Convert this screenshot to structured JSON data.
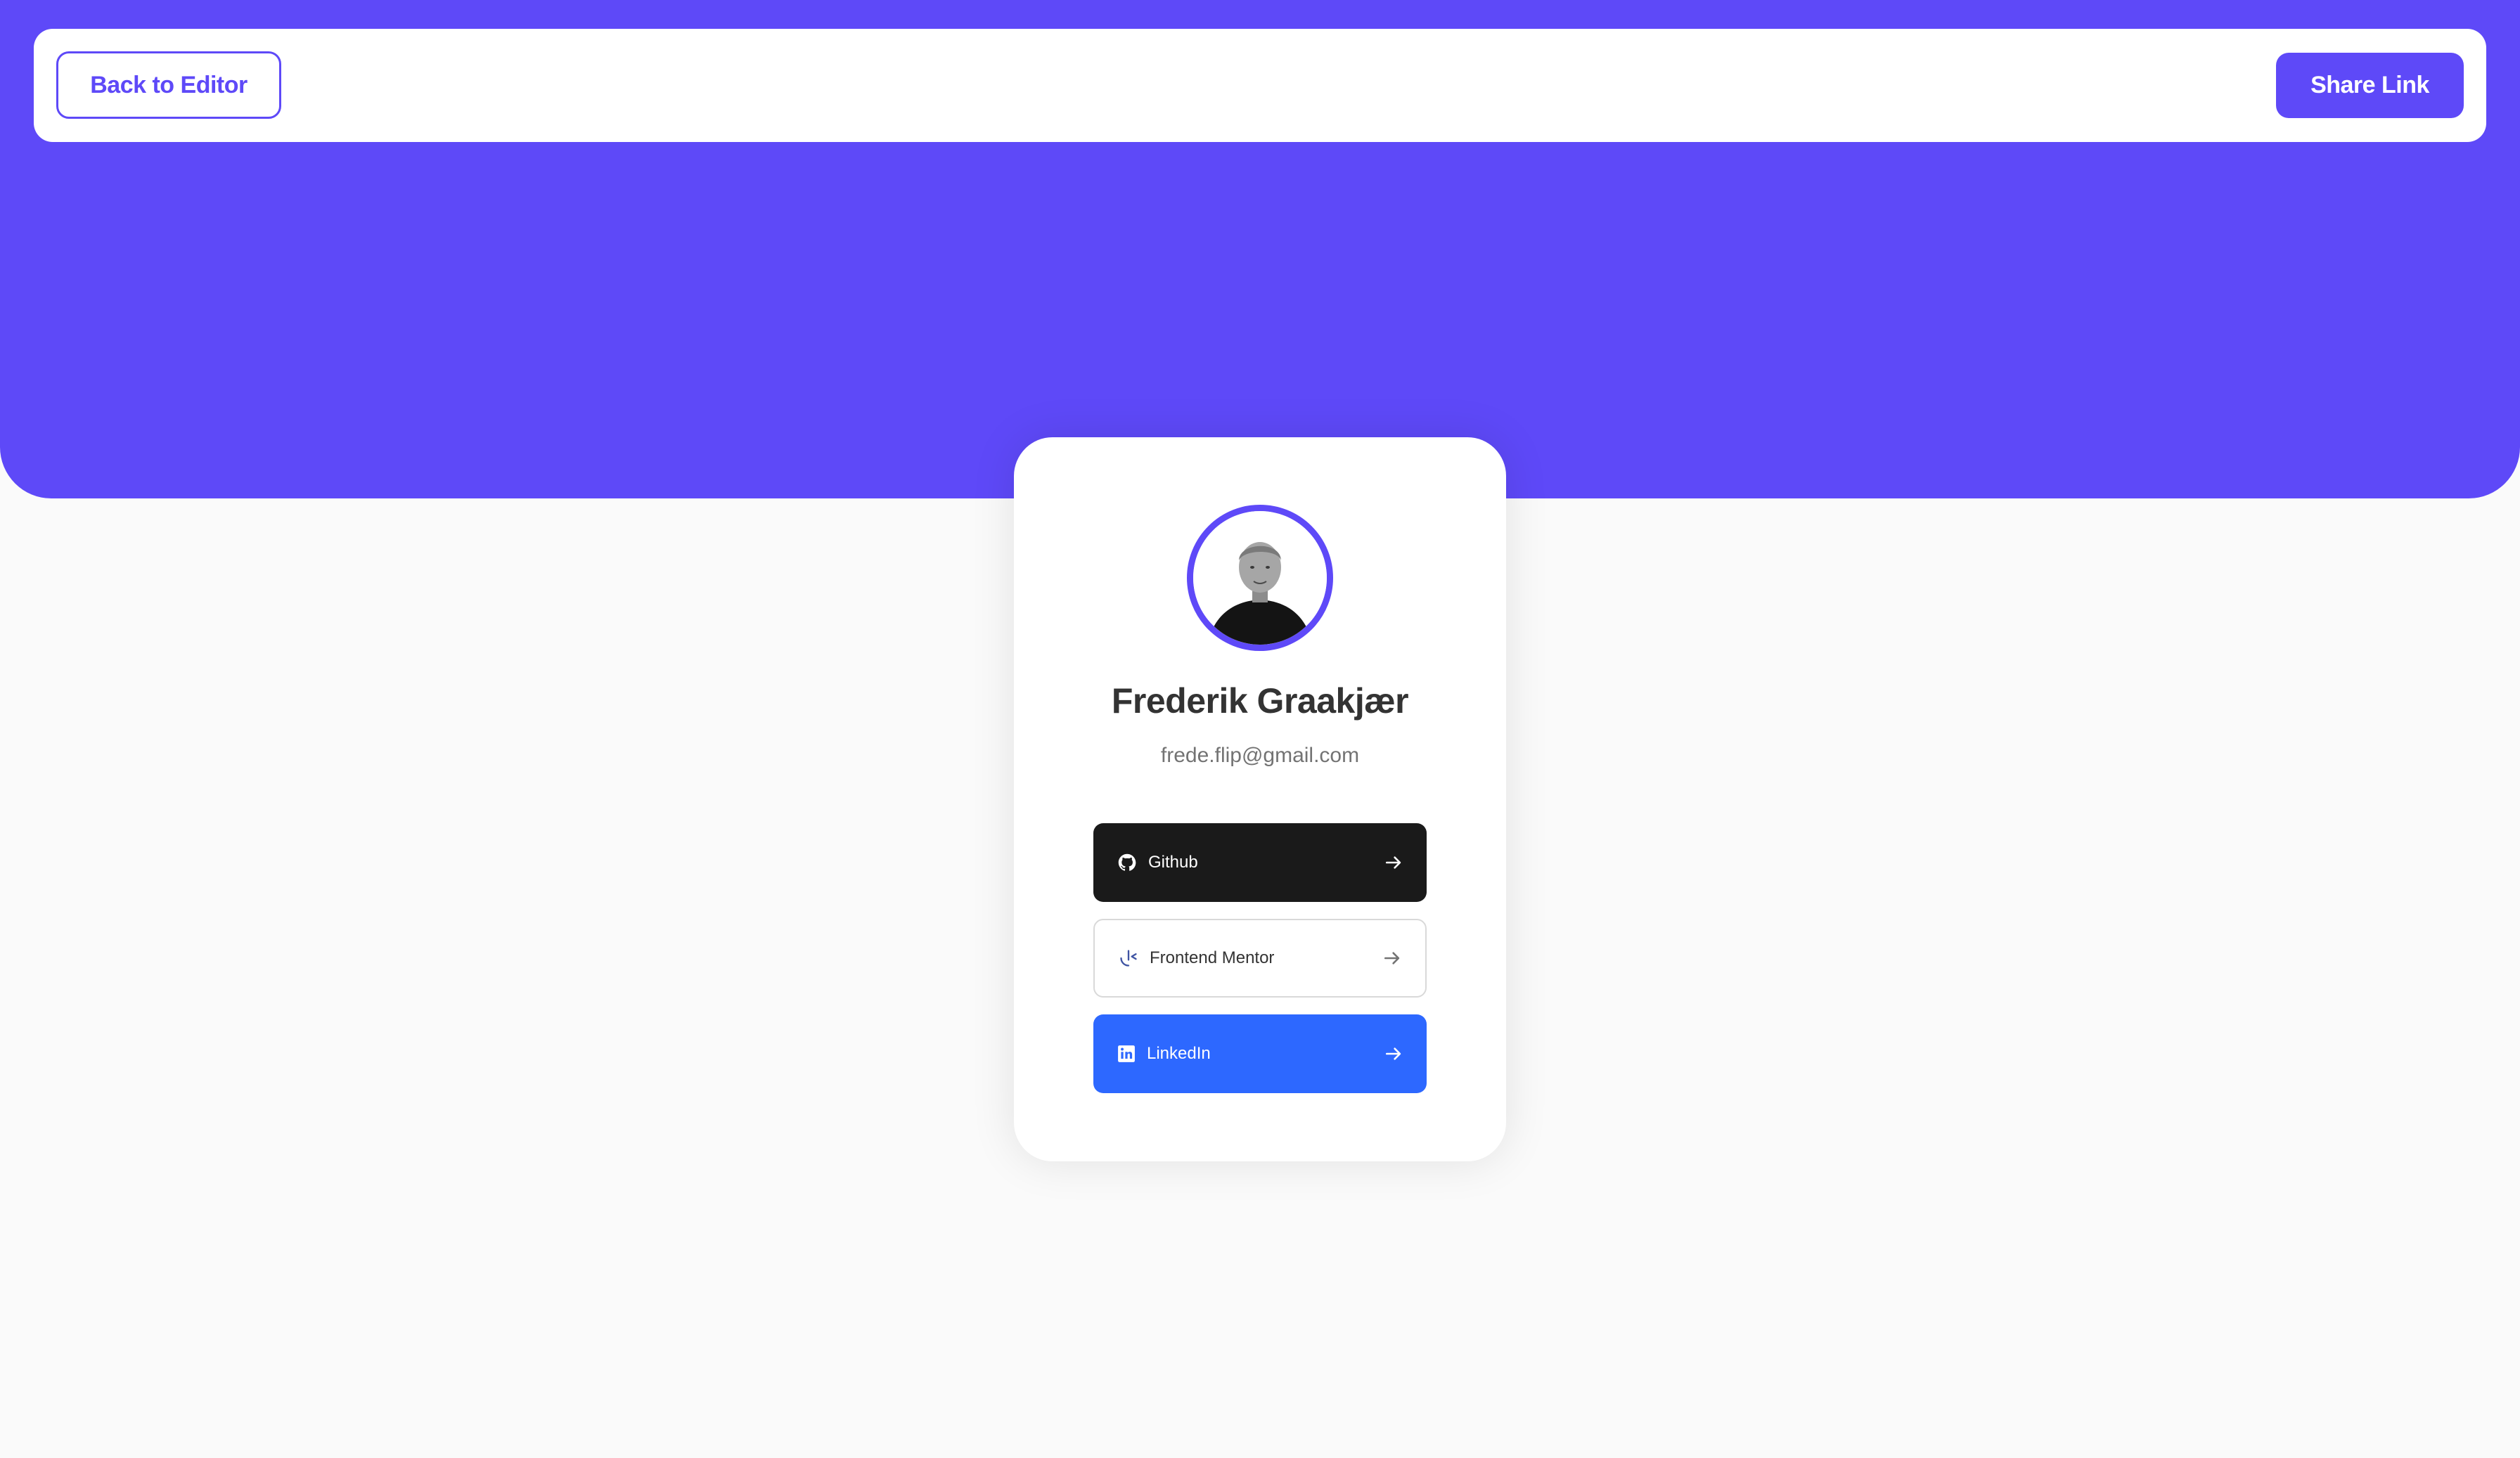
{
  "nav": {
    "back_label": "Back to Editor",
    "share_label": "Share Link"
  },
  "profile": {
    "name": "Frederik Graakjær",
    "email": "frede.flip@gmail.com"
  },
  "links": [
    {
      "platform": "Github",
      "icon": "github-icon",
      "color": "#1A1A1A"
    },
    {
      "platform": "Frontend Mentor",
      "icon": "frontend-mentor-icon",
      "color": "#FFFFFF"
    },
    {
      "platform": "LinkedIn",
      "icon": "linkedin-icon",
      "color": "#2D68FF"
    }
  ],
  "colors": {
    "accent": "#5E49F8",
    "background": "#FAFAFA",
    "card": "#FFFFFF"
  }
}
